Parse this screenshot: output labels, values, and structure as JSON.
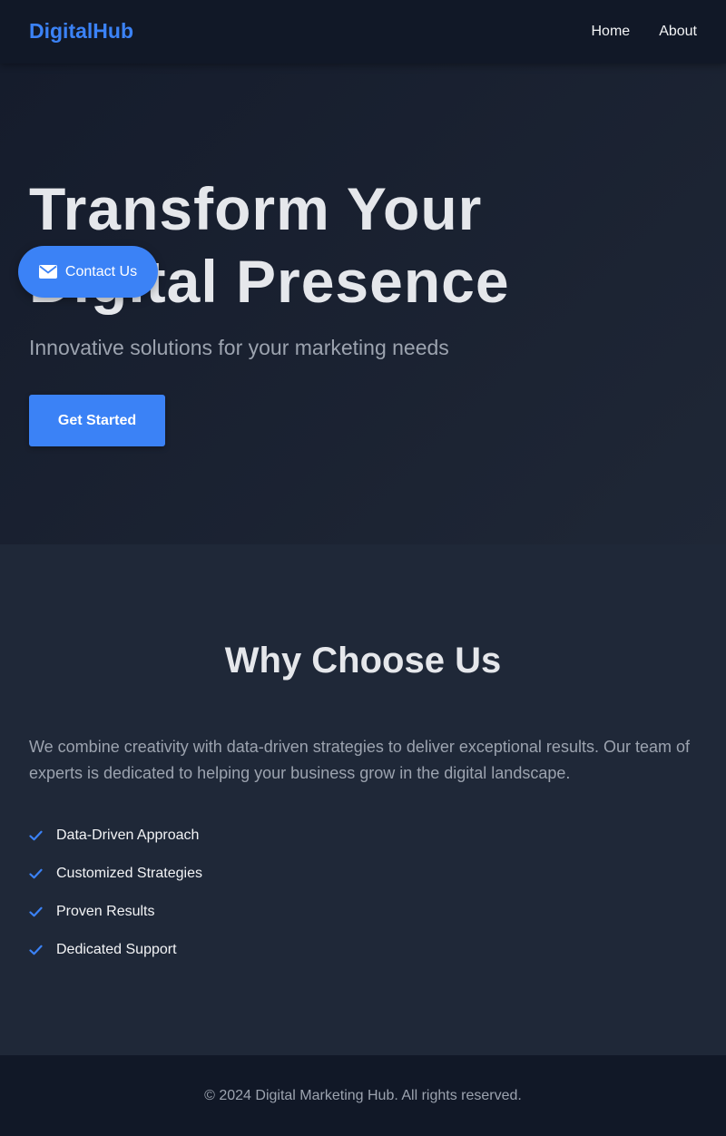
{
  "nav": {
    "brand": "DigitalHub",
    "links": [
      "Home",
      "About"
    ]
  },
  "hero": {
    "title": "Transform Your Digital Presence",
    "subtitle": "Innovative solutions for your marketing needs",
    "cta_label": "Get Started"
  },
  "contact_button": {
    "label": "Contact Us",
    "icon": "envelope-icon"
  },
  "why": {
    "title": "Why Choose Us",
    "description": "We combine creativity with data-driven strategies to deliver exceptional results. Our team of experts is dedicated to helping your business grow in the digital landscape.",
    "features": [
      "Data-Driven Approach",
      "Customized Strategies",
      "Proven Results",
      "Dedicated Support"
    ],
    "feature_icon": "check-icon"
  },
  "footer": {
    "text": "© 2024 Digital Marketing Hub. All rights reserved."
  },
  "colors": {
    "accent": "#3b82f6",
    "nav_bg": "#111827",
    "section_bg": "#1f2838",
    "text_muted": "#9ca3af"
  }
}
